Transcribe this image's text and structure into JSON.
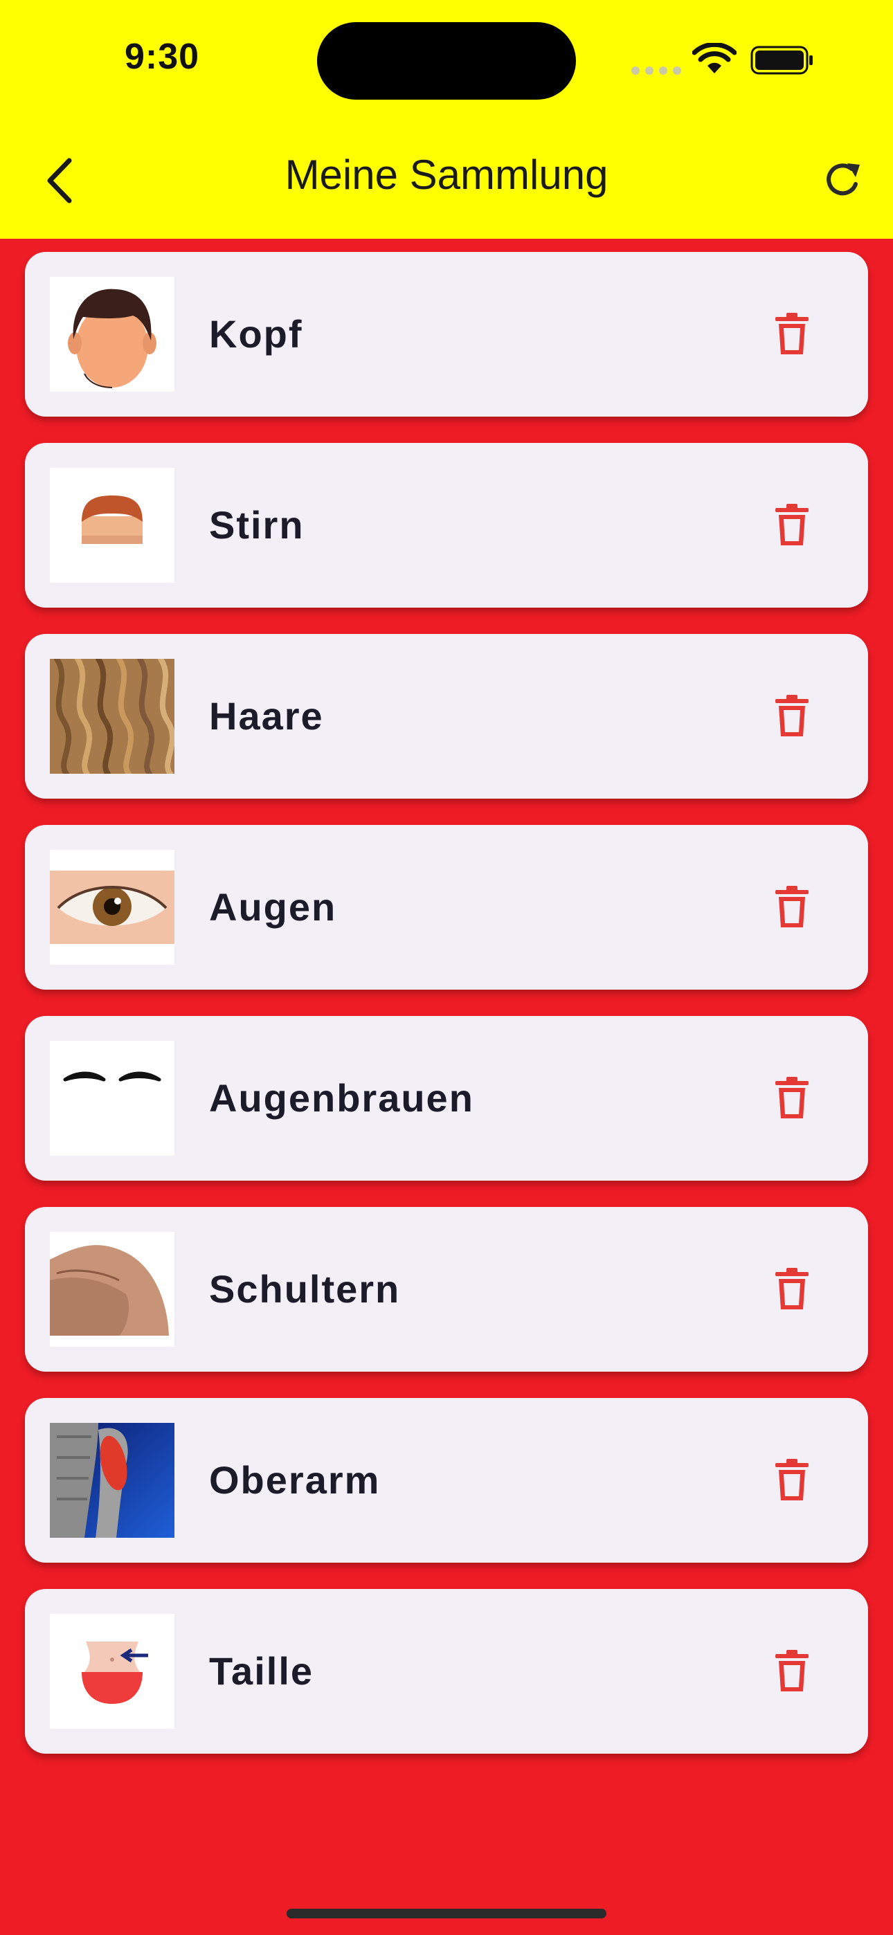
{
  "status_bar": {
    "time": "9:30"
  },
  "app_bar": {
    "title": "Meine Sammlung",
    "back_icon": "chevron-left-icon",
    "refresh_icon": "refresh-icon"
  },
  "colors": {
    "app_bar_bg": "#FFFF00",
    "page_bg": "#EE1C25",
    "card_bg": "#F3EFF7",
    "delete_icon": "#E53935"
  },
  "items": [
    {
      "label": "Kopf",
      "image": "head-image"
    },
    {
      "label": "Stirn",
      "image": "forehead-image"
    },
    {
      "label": "Haare",
      "image": "hair-image"
    },
    {
      "label": "Augen",
      "image": "eye-image"
    },
    {
      "label": "Augenbrauen",
      "image": "eyebrows-image"
    },
    {
      "label": "Schultern",
      "image": "shoulder-image"
    },
    {
      "label": "Oberarm",
      "image": "upper-arm-image"
    },
    {
      "label": "Taille",
      "image": "waist-image"
    }
  ]
}
